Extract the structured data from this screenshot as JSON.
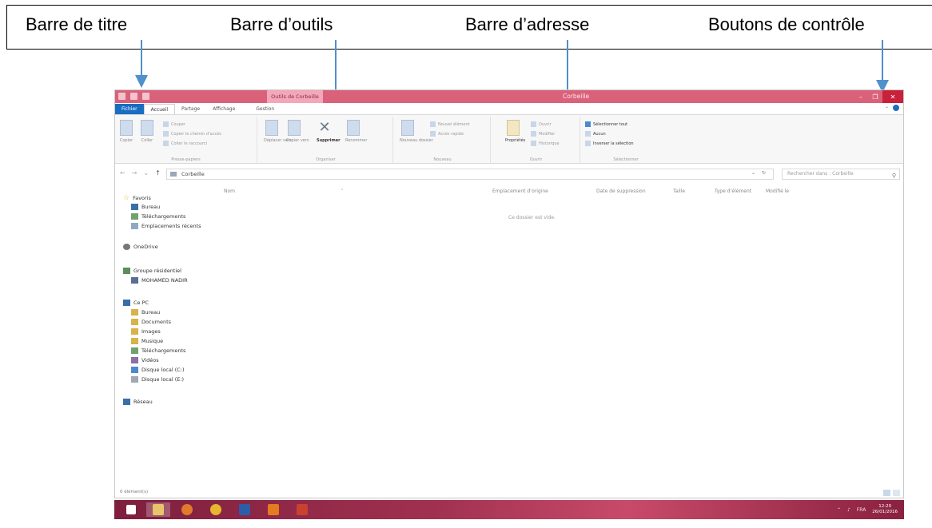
{
  "annotations": {
    "title_bar": "Barre de titre",
    "toolbar": "Barre d’outils",
    "address_bar": "Barre d’adresse",
    "control_buttons": "Boutons de contrôle"
  },
  "window": {
    "title": "Corbeille",
    "context_tab": "Outils de Corbeille",
    "accent": "#d9627a"
  },
  "tabs": [
    "Fichier",
    "Accueil",
    "Partage",
    "Affichage",
    "Gestion"
  ],
  "ribbon": {
    "groups": [
      "Presse-papiers",
      "Organiser",
      "Nouveau",
      "Ouvrir",
      "Sélectionner"
    ],
    "copy": "Copier",
    "paste": "Coller",
    "cut": "Couper",
    "copy_path": "Copier le chemin d’accès",
    "paste_shortcut": "Coller le raccourci",
    "move_to": "Déplacer vers",
    "copy_to": "Copier vers",
    "delete": "Supprimer",
    "rename": "Renommer",
    "new_folder": "Nouveau dossier",
    "new_item": "Nouvel élément",
    "easy_access": "Accès rapide",
    "properties": "Propriétés",
    "open": "Ouvrir",
    "modify": "Modifier",
    "history": "Historique",
    "select_all": "Sélectionner tout",
    "select_none": "Aucun",
    "invert_selection": "Inverser la sélection"
  },
  "address": {
    "path": "Corbeille",
    "search_placeholder": "Rechercher dans : Corbeille"
  },
  "nav_pane": [
    "Favoris",
    "Bureau",
    "Téléchargements",
    "Emplacements récents",
    "OneDrive",
    "Groupe résidentiel",
    "MOHAMED NADIR",
    "Ce PC",
    "Bureau",
    "Documents",
    "Images",
    "Musique",
    "Téléchargements",
    "Vidéos",
    "Disque local (C:)",
    "Disque local (E:)",
    "Réseau"
  ],
  "columns": [
    "Nom",
    "Emplacement d’origine",
    "Date de suppression",
    "Taille",
    "Type d’élément",
    "Modifié le"
  ],
  "empty_message": "Ce dossier est vide.",
  "status": "0 élément(s)",
  "tray": {
    "language": "FRA",
    "time": "12:20",
    "date": "26/01/2016"
  }
}
